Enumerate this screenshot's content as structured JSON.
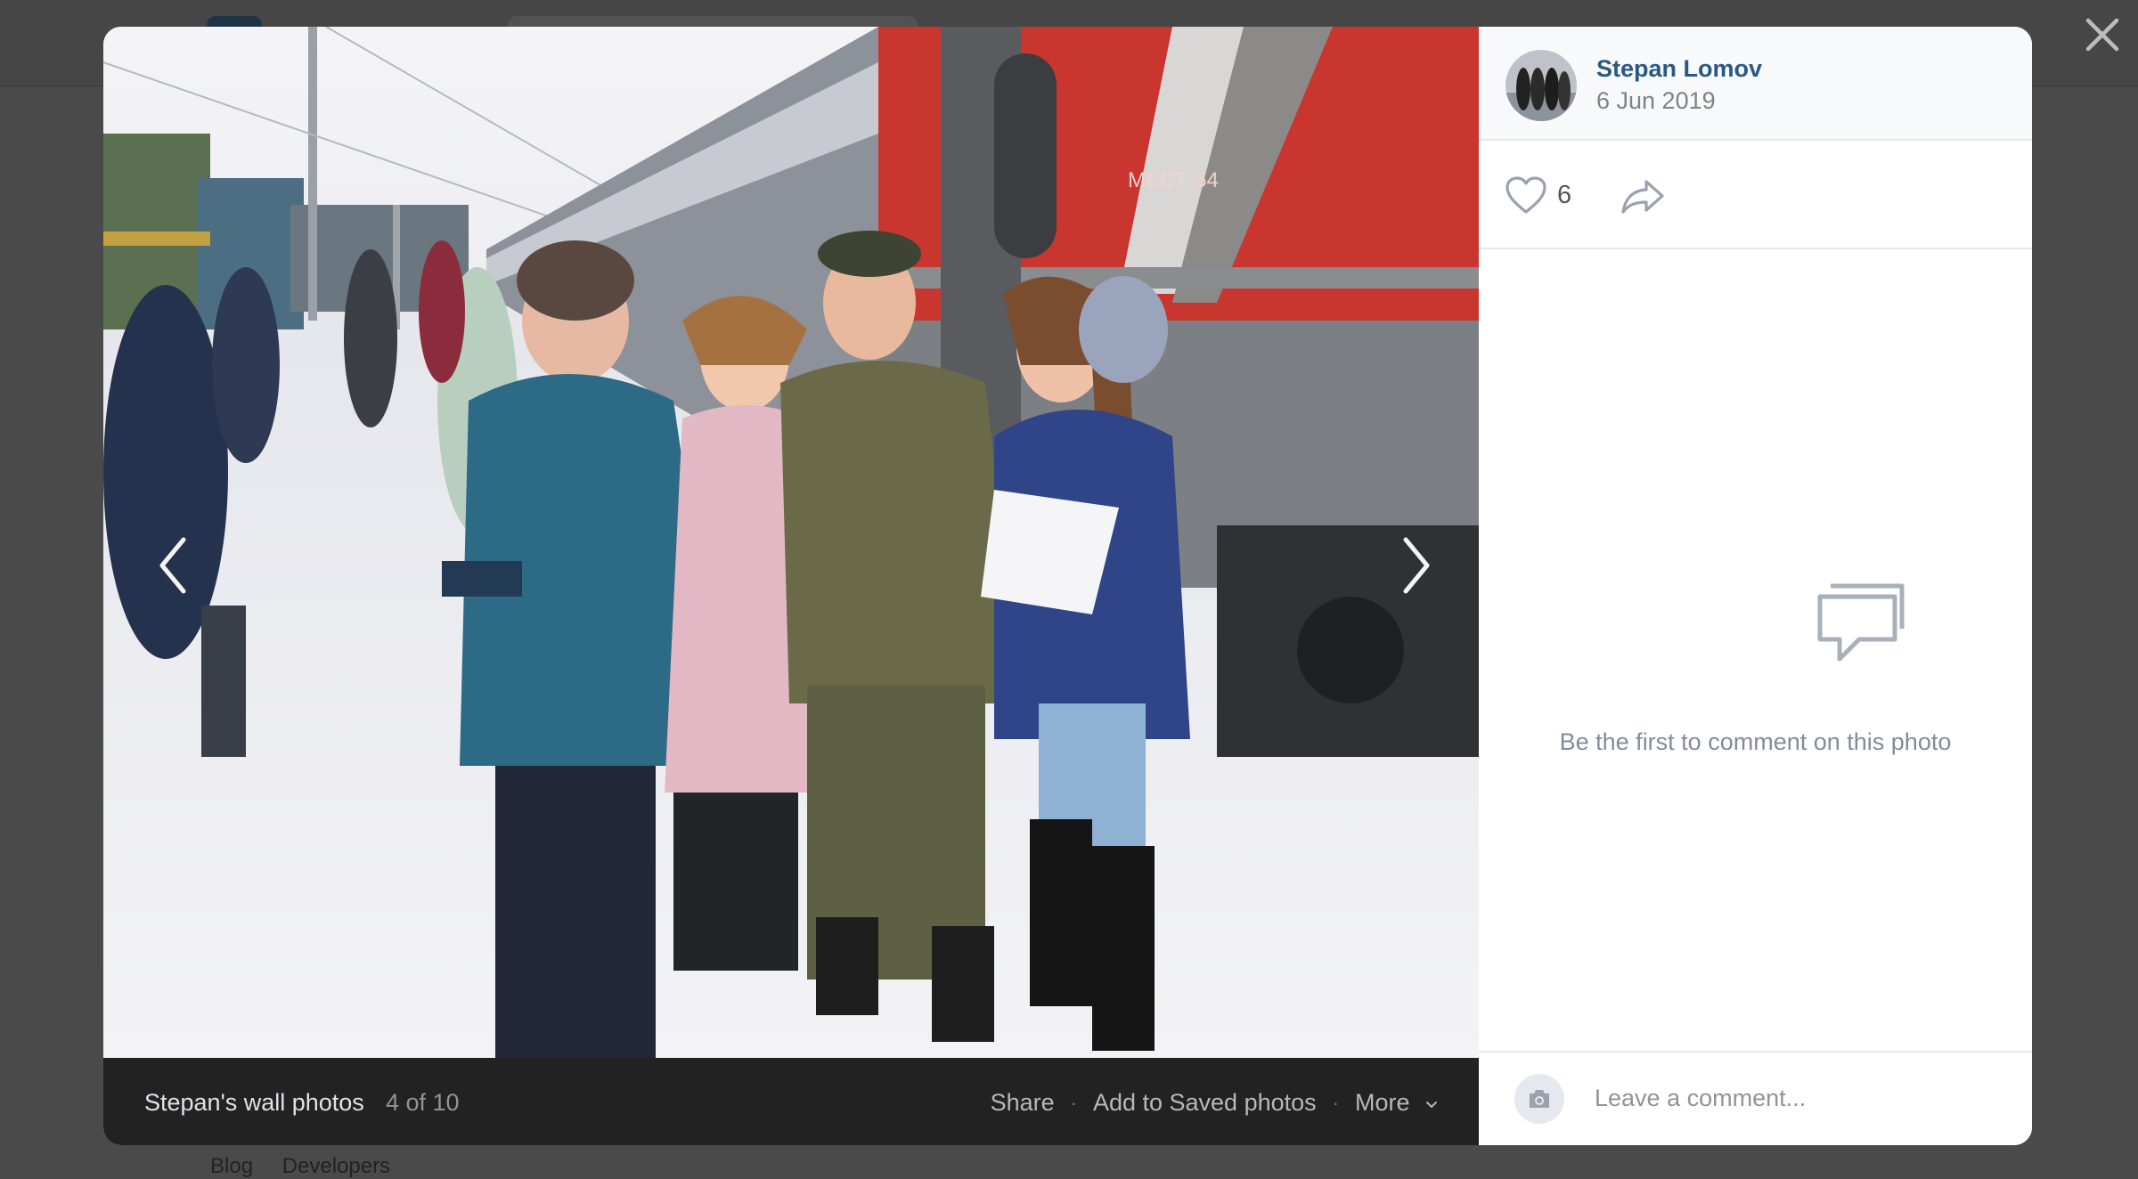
{
  "viewer": {
    "author_name": "Stepan Lomov",
    "date": "6 Jun 2019",
    "likes": "6",
    "empty_comments_text": "Be the first to comment on this photo",
    "comment_placeholder": "Leave a comment...",
    "album_title": "Stepan's wall photos",
    "photo_counter": "4 of 10",
    "actions": {
      "share": "Share",
      "save": "Add to Saved photos",
      "more": "More"
    },
    "photo_sign_text": "МЕСТ-54"
  },
  "background_page": {
    "footer_links": [
      "Blog",
      "Developers"
    ]
  },
  "icons": [
    "close-icon",
    "arrow-left-icon",
    "arrow-right-icon",
    "heart-icon",
    "share-icon",
    "comments-icon",
    "camera-icon",
    "chevron-down-icon"
  ],
  "colors": {
    "overlay": "#4a4a4a",
    "author_link": "#2a5885",
    "bar_bg": "#222222",
    "train_red": "#c8362f"
  }
}
